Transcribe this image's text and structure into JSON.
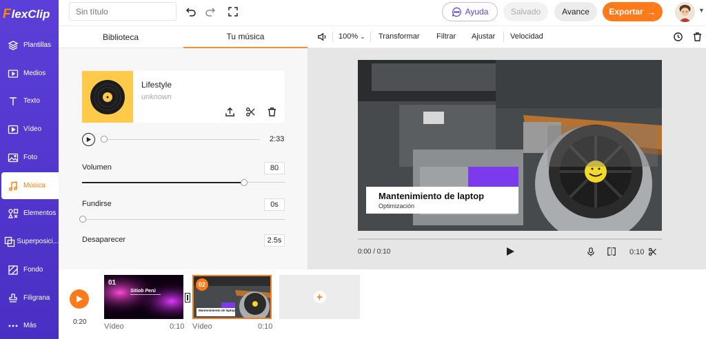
{
  "brand": {
    "logo_f": "F",
    "logo_rest": "lexClip",
    "accent": "#ff7a1a",
    "primary": "#5b3fd8"
  },
  "sidebar": {
    "items": [
      {
        "label": "Plantillas",
        "icon": "layers-icon"
      },
      {
        "label": "Medios",
        "icon": "media-folder-icon"
      },
      {
        "label": "Texto",
        "icon": "text-icon"
      },
      {
        "label": "Vídeo",
        "icon": "video-icon"
      },
      {
        "label": "Foto",
        "icon": "photo-icon"
      },
      {
        "label": "Música",
        "icon": "music-icon",
        "active": true
      },
      {
        "label": "Elementos",
        "icon": "elements-icon"
      },
      {
        "label": "Superposici...",
        "icon": "overlay-icon"
      },
      {
        "label": "Fondo",
        "icon": "background-icon"
      },
      {
        "label": "Filigrana",
        "icon": "watermark-icon"
      },
      {
        "label": "Más",
        "icon": "more-icon"
      }
    ]
  },
  "topbar": {
    "title_placeholder": "Sin título",
    "help_label": "Ayuda",
    "saved_label": "Salvado",
    "advance_label": "Avance",
    "export_label": "Exportar",
    "export_arrow": "→"
  },
  "panel": {
    "tabs": [
      "Biblioteca",
      "Tu música"
    ],
    "active_tab": 1,
    "song": {
      "title": "Lifestyle",
      "artist": "unknown",
      "duration": "2:33",
      "progress": 0
    },
    "volume": {
      "label": "Volumen",
      "value": "80",
      "level": 0.8
    },
    "fade_in": {
      "label": "Fundirse",
      "value": "0s",
      "level": 0
    },
    "fade_out": {
      "label": "Desaparecer",
      "value": "2.5s"
    }
  },
  "preview_toolbar": {
    "zoom": "100%",
    "items": [
      "Transformar",
      "Filtrar",
      "Ajustar",
      "Velocidad"
    ]
  },
  "preview": {
    "caption_title": "Mantenimiento de laptop",
    "caption_subtitle": "Optimización",
    "current_time": "0:00 / 0:10",
    "clip_duration": "0:10"
  },
  "timeline": {
    "total_time": "0:20",
    "clips": [
      {
        "number": "01",
        "label": "Vídeo",
        "duration": "0:10",
        "thumb_text": "Sitiob Perú"
      },
      {
        "number": "02",
        "label": "Vídeo",
        "duration": "0:10",
        "thumb_text": "Mantenimiento de laptop",
        "selected": true
      }
    ],
    "add_symbol": "+"
  }
}
